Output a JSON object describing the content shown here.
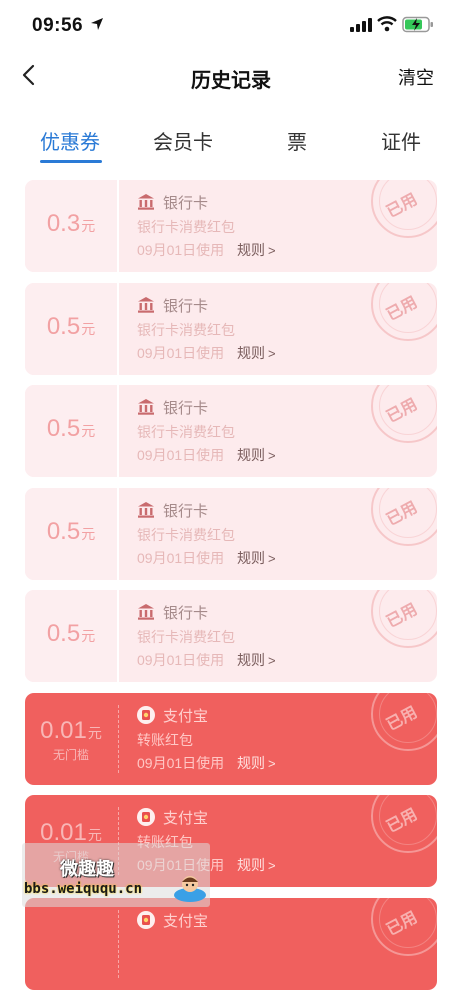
{
  "status_bar": {
    "time": "09:56"
  },
  "nav": {
    "title": "历史记录",
    "clear_label": "清空"
  },
  "tabs": [
    {
      "label": "优惠券",
      "active": true
    },
    {
      "label": "会员卡",
      "active": false
    },
    {
      "label": "票",
      "active": false
    },
    {
      "label": "证件",
      "active": false
    }
  ],
  "colors": {
    "accent": "#2a7ad6",
    "used_bg": "#fdebed",
    "active_red": "#f0605e"
  },
  "coupons": [
    {
      "amount": "0.3",
      "unit": "元",
      "sub": "",
      "brand": "银行卡",
      "brand_icon": "bank-icon",
      "desc": "银行卡消费红包",
      "date": "09月01日使用",
      "rules": "规则",
      "stamp": "已用",
      "style": "used"
    },
    {
      "amount": "0.5",
      "unit": "元",
      "sub": "",
      "brand": "银行卡",
      "brand_icon": "bank-icon",
      "desc": "银行卡消费红包",
      "date": "09月01日使用",
      "rules": "规则",
      "stamp": "已用",
      "style": "used"
    },
    {
      "amount": "0.5",
      "unit": "元",
      "sub": "",
      "brand": "银行卡",
      "brand_icon": "bank-icon",
      "desc": "银行卡消费红包",
      "date": "09月01日使用",
      "rules": "规则",
      "stamp": "已用",
      "style": "used"
    },
    {
      "amount": "0.5",
      "unit": "元",
      "sub": "",
      "brand": "银行卡",
      "brand_icon": "bank-icon",
      "desc": "银行卡消费红包",
      "date": "09月01日使用",
      "rules": "规则",
      "stamp": "已用",
      "style": "used"
    },
    {
      "amount": "0.5",
      "unit": "元",
      "sub": "",
      "brand": "银行卡",
      "brand_icon": "bank-icon",
      "desc": "银行卡消费红包",
      "date": "09月01日使用",
      "rules": "规则",
      "stamp": "已用",
      "style": "used"
    },
    {
      "amount": "0.01",
      "unit": "元",
      "sub": "无门槛",
      "brand": "支付宝",
      "brand_icon": "alipay-redpacket-icon",
      "desc": "转账红包",
      "date": "09月01日使用",
      "rules": "规则",
      "stamp": "已用",
      "style": "red"
    },
    {
      "amount": "0.01",
      "unit": "元",
      "sub": "无门槛",
      "brand": "支付宝",
      "brand_icon": "alipay-redpacket-icon",
      "desc": "转账红包",
      "date": "09月01日使用",
      "rules": "规则",
      "stamp": "已用",
      "style": "red"
    },
    {
      "amount": "",
      "unit": "",
      "sub": "",
      "brand": "支付宝",
      "brand_icon": "alipay-redpacket-icon",
      "desc": "",
      "date": "",
      "rules": "",
      "stamp": "已用",
      "style": "red"
    }
  ],
  "watermark": {
    "title": "微趣趣",
    "url": "bbs.weiququ.cn"
  }
}
